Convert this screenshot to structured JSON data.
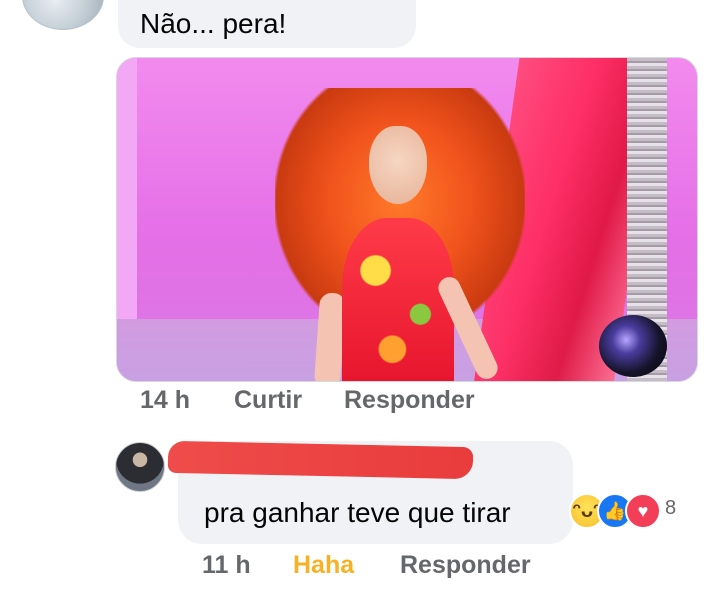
{
  "comment_1": {
    "text": "Não... pera!",
    "time": "14 h",
    "like_label": "Curtir",
    "reply_label": "Responder"
  },
  "comment_2": {
    "text": "pra ganhar teve que tirar",
    "time": "11 h",
    "reaction_label": "Haha",
    "reply_label": "Responder",
    "reaction_count": "8",
    "reactions": [
      "haha-icon",
      "like-icon",
      "love-icon"
    ]
  },
  "colors": {
    "bubble": "#f0f2f5",
    "meta_text": "#65676b",
    "haha_active": "#f7b125",
    "like": "#1877f2",
    "love": "#f33e58"
  }
}
